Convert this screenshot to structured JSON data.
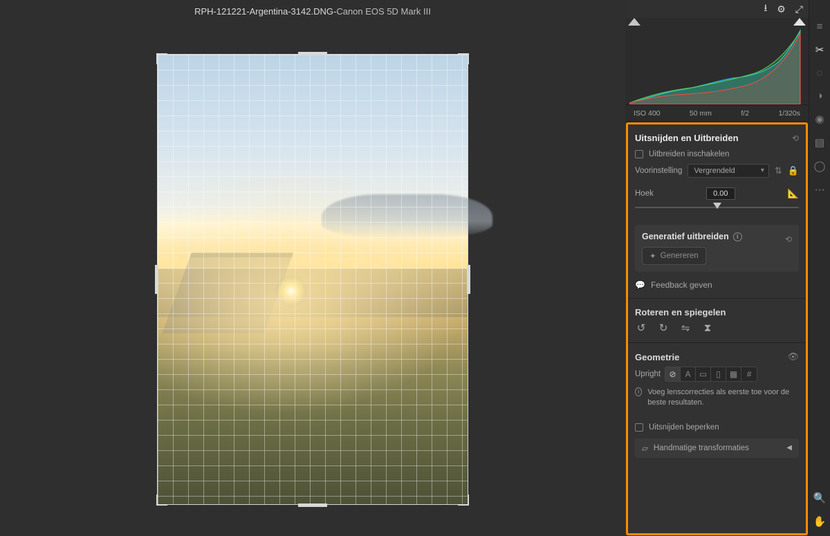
{
  "title": {
    "file": "RPH-121221-Argentina-3142.DNG",
    "sep": " - ",
    "camera": "Canon EOS 5D Mark III"
  },
  "histogram": {
    "iso": "ISO 400",
    "focal": "50 mm",
    "aperture": "f/2",
    "shutter": "1/320s"
  },
  "crop": {
    "heading": "Uitsnijden en Uitbreiden",
    "extend_label": "Uitbreiden inschakelen",
    "preset_label": "Voorinstelling",
    "preset_value": "Vergrendeld",
    "angle_label": "Hoek",
    "angle_value": "0.00"
  },
  "genex": {
    "heading": "Generatief uitbreiden",
    "generate": "Genereren",
    "feedback": "Feedback geven"
  },
  "rotate": {
    "heading": "Roteren en spiegelen"
  },
  "geometry": {
    "heading": "Geometrie",
    "upright_label": "Upright",
    "hint": "Voeg lenscorrecties als eerste toe voor de beste resultaten.",
    "constrain": "Uitsnijden beperken",
    "manual": "Handmatige transformaties"
  }
}
